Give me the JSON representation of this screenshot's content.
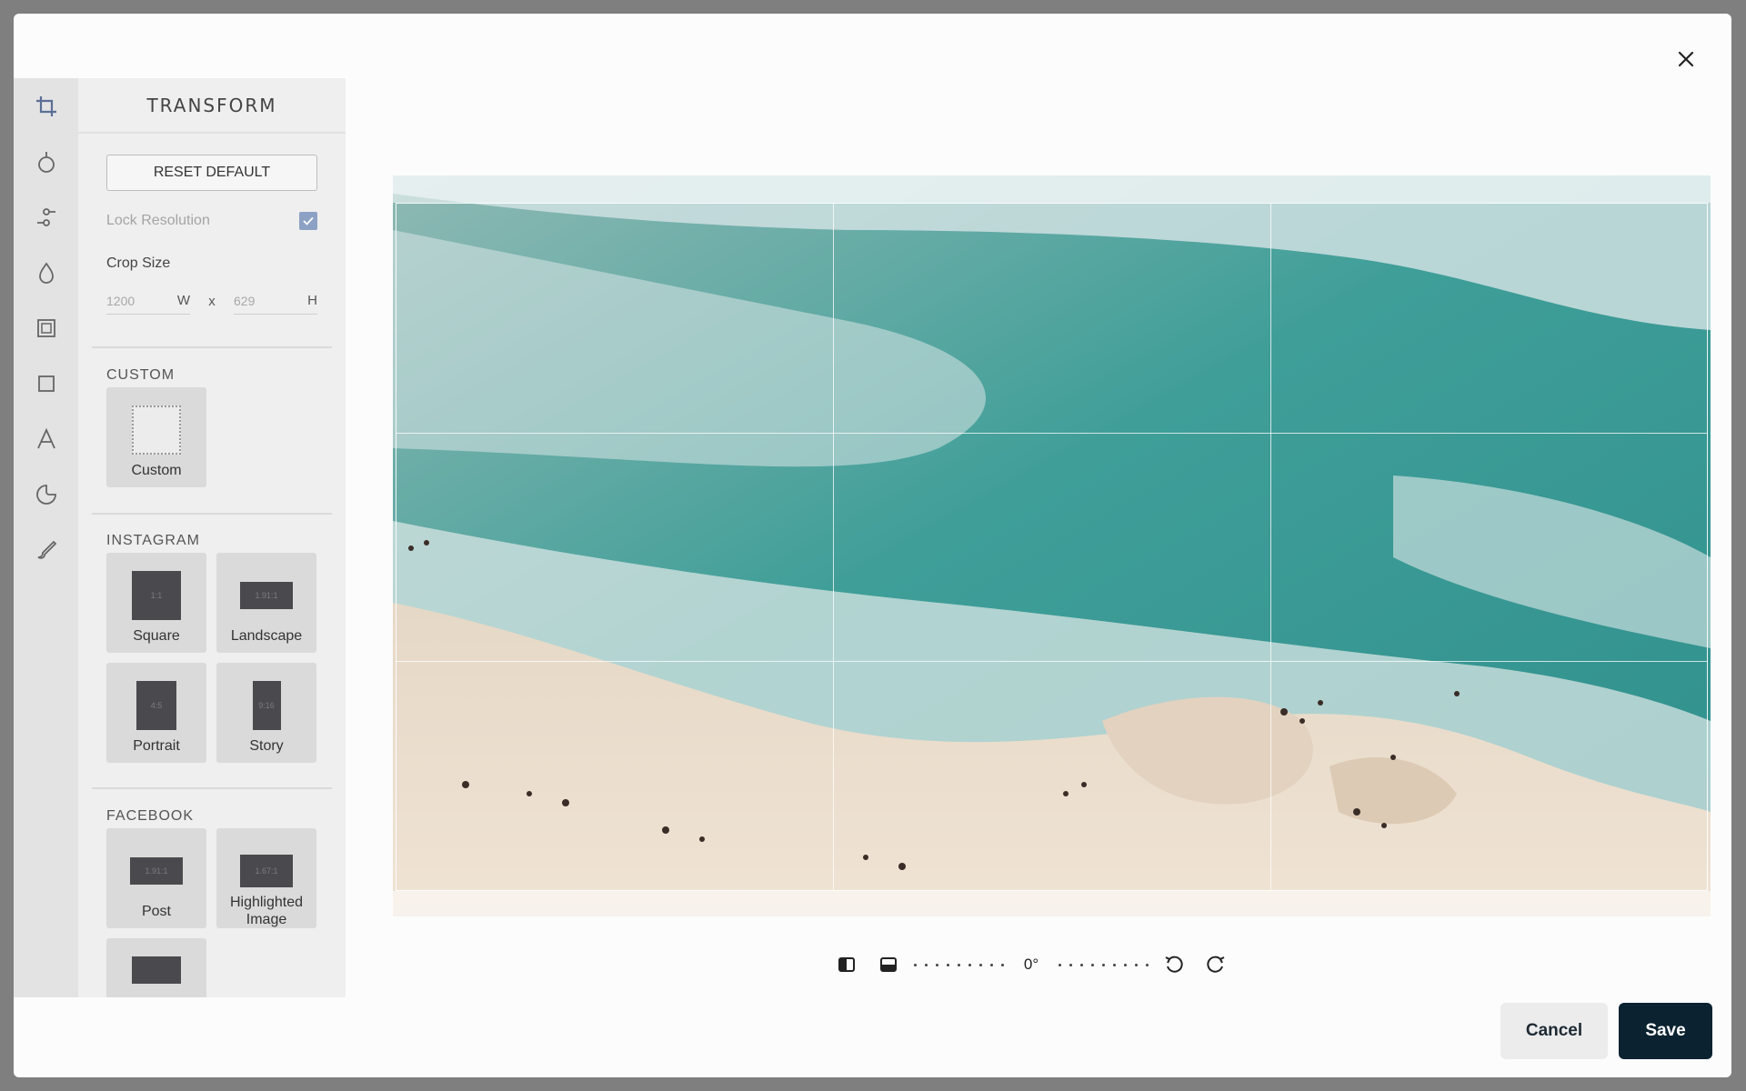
{
  "header": {
    "close_icon": "close-icon"
  },
  "tool_rail": {
    "tools": [
      {
        "icon": "crop-icon",
        "active": true
      },
      {
        "icon": "drop-icon"
      },
      {
        "icon": "sliders-icon"
      },
      {
        "icon": "droplet-icon"
      },
      {
        "icon": "frame-icon"
      },
      {
        "icon": "square-icon"
      },
      {
        "icon": "text-icon"
      },
      {
        "icon": "sticker-icon"
      },
      {
        "icon": "brush-icon"
      }
    ]
  },
  "panel": {
    "title": "TRANSFORM",
    "reset_label": "RESET DEFAULT",
    "lock_resolution_label": "Lock Resolution",
    "lock_resolution_checked": true,
    "crop_size_label": "Crop Size",
    "crop_width": "1200",
    "crop_width_unit": "W",
    "crop_separator": "x",
    "crop_height": "629",
    "crop_height_unit": "H",
    "sections": {
      "custom": {
        "label": "CUSTOM",
        "presets": [
          {
            "name": "Custom"
          }
        ]
      },
      "instagram": {
        "label": "INSTAGRAM",
        "presets": [
          {
            "name": "Square",
            "ratio": "1:1"
          },
          {
            "name": "Landscape",
            "ratio": "1.91:1"
          },
          {
            "name": "Portrait",
            "ratio": "4:5"
          },
          {
            "name": "Story",
            "ratio": "9:16"
          }
        ]
      },
      "facebook": {
        "label": "FACEBOOK",
        "presets": [
          {
            "name": "Post",
            "ratio": "1.91:1"
          },
          {
            "name": "Highlighted Image",
            "ratio": "1.67:1"
          }
        ]
      }
    }
  },
  "controls": {
    "flip_horizontal_icon": "flip-horizontal-icon",
    "flip_vertical_icon": "flip-vertical-icon",
    "angle": "0°",
    "rotate_left_icon": "rotate-left-icon",
    "rotate_right_icon": "rotate-right-icon"
  },
  "footer": {
    "cancel_label": "Cancel",
    "save_label": "Save"
  },
  "colors": {
    "save_bg": "#0b2230",
    "accent_check": "#8da1c4"
  }
}
